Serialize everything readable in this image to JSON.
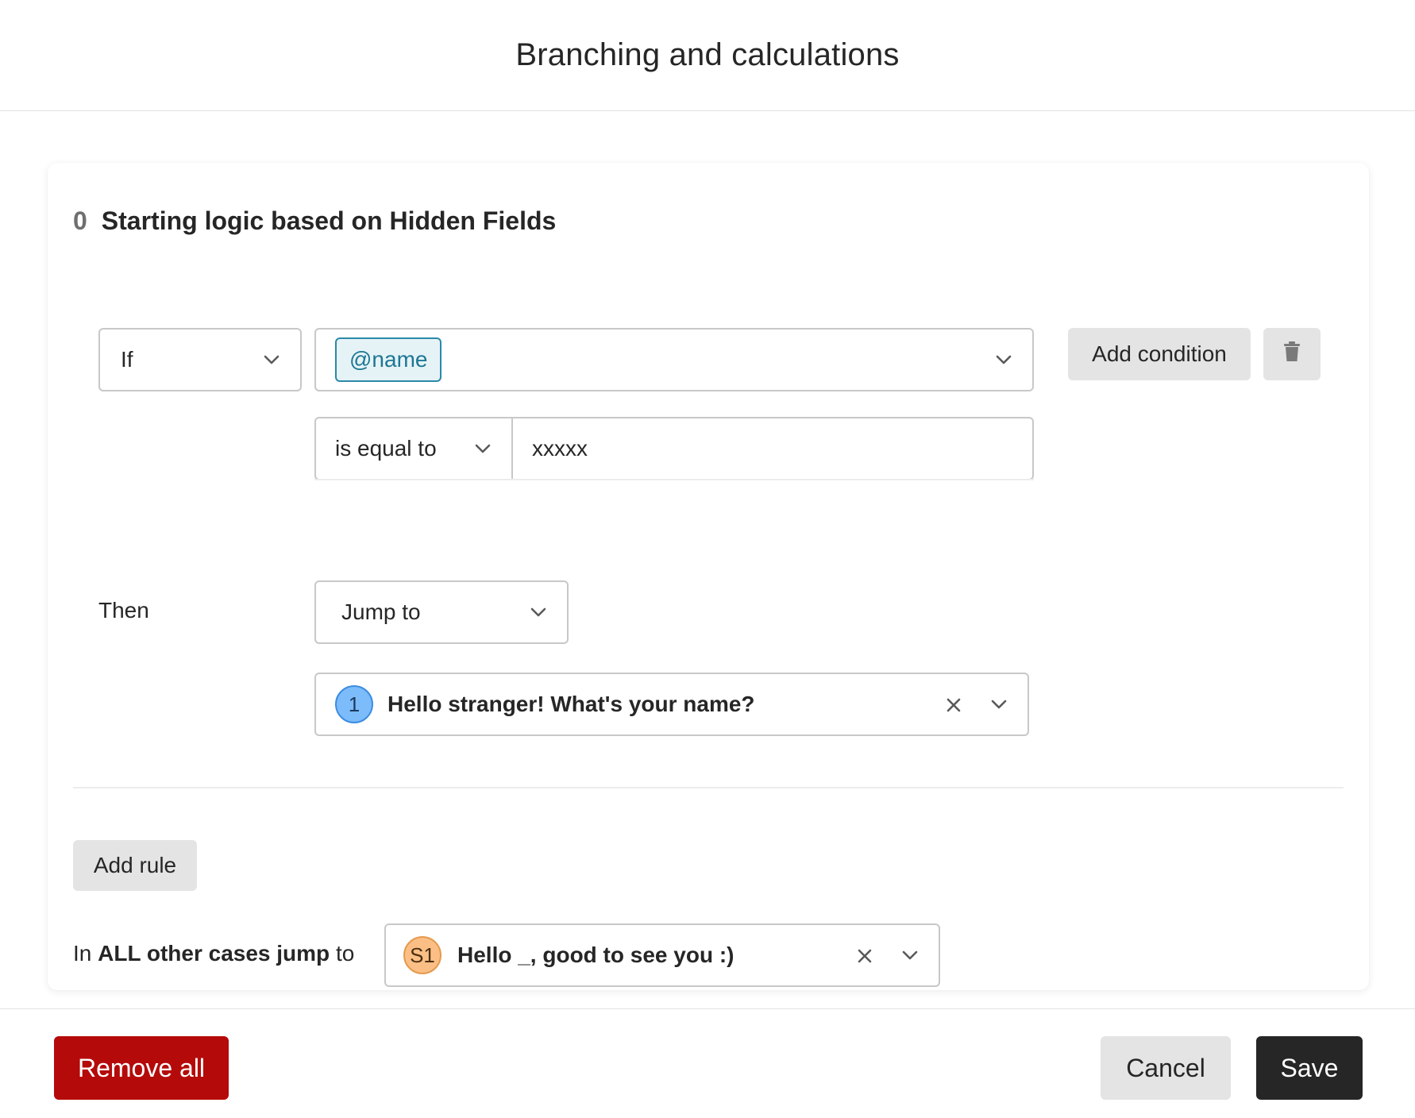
{
  "header": {
    "title": "Branching and calculations"
  },
  "rule": {
    "index": "0",
    "title": "Starting logic based on Hidden Fields",
    "if_select": "If",
    "field_tag": "@name",
    "operator": "is equal to",
    "value": "xxxxx",
    "add_condition_label": "Add condition",
    "then_label": "Then",
    "action": "Jump to",
    "destination": {
      "badge": "1",
      "text": "Hello stranger! What's your name?",
      "badge_color": "#7cbcfb"
    }
  },
  "add_rule_label": "Add rule",
  "other_cases": {
    "prefix": "In",
    "bold": "ALL other cases jump",
    "suffix": "to",
    "destination": {
      "badge": "S1",
      "text": "Hello _, good to see you :)",
      "badge_color": "#fbbf85"
    }
  },
  "footer": {
    "remove_all_label": "Remove all",
    "cancel_label": "Cancel",
    "save_label": "Save",
    "danger_color": "#b50a0a"
  }
}
